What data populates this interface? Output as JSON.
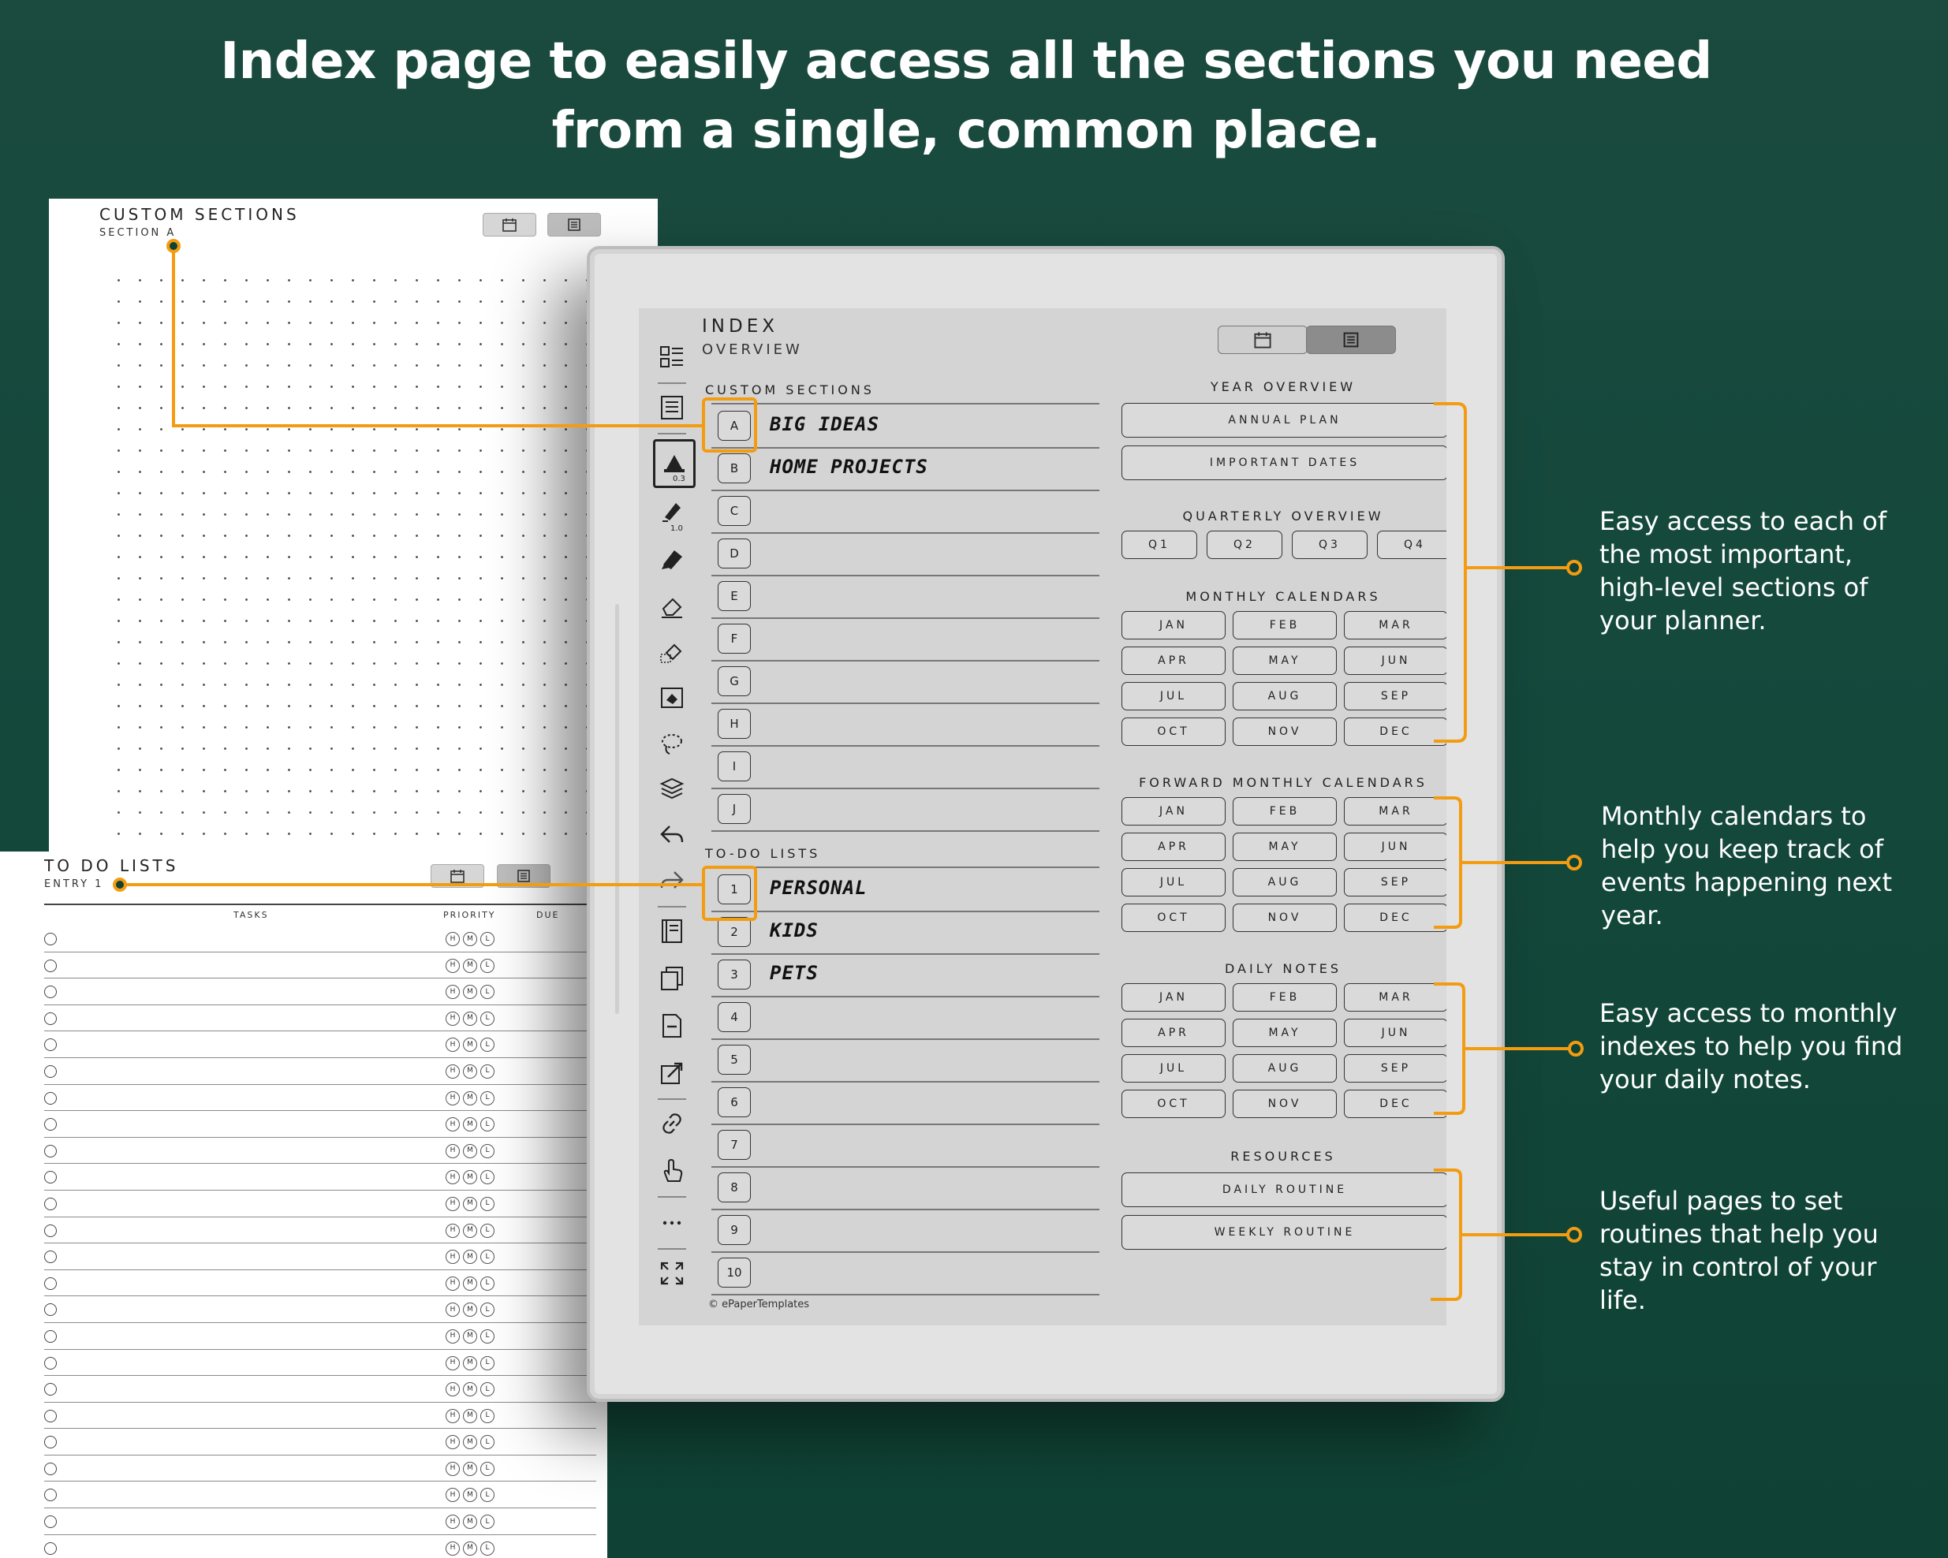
{
  "headline": {
    "line1": "Index page to easily access all the sections you need",
    "line2": "from a single, common place."
  },
  "page_a": {
    "title": "CUSTOM SECTIONS",
    "subtitle": "SECTION A"
  },
  "page_todo": {
    "title": "TO DO LISTS",
    "subtitle": "ENTRY 1",
    "col_tasks": "TASKS",
    "col_priority": "PRIORITY",
    "col_due": "DUE",
    "priority_levels": [
      "H",
      "M",
      "L"
    ]
  },
  "screen": {
    "title": "INDEX",
    "subtitle": "OVERVIEW",
    "custom_sections_label": "CUSTOM SECTIONS",
    "custom_sections": [
      {
        "key": "A",
        "text": "BIG IDEAS"
      },
      {
        "key": "B",
        "text": "HOME PROJECTS"
      },
      {
        "key": "C",
        "text": ""
      },
      {
        "key": "D",
        "text": ""
      },
      {
        "key": "E",
        "text": ""
      },
      {
        "key": "F",
        "text": ""
      },
      {
        "key": "G",
        "text": ""
      },
      {
        "key": "H",
        "text": ""
      },
      {
        "key": "I",
        "text": ""
      },
      {
        "key": "J",
        "text": ""
      }
    ],
    "todo_label": "TO-DO LISTS",
    "todo_lists": [
      {
        "key": "1",
        "text": "PERSONAL"
      },
      {
        "key": "2",
        "text": "KIDS"
      },
      {
        "key": "3",
        "text": "PETS"
      },
      {
        "key": "4",
        "text": ""
      },
      {
        "key": "5",
        "text": ""
      },
      {
        "key": "6",
        "text": ""
      },
      {
        "key": "7",
        "text": ""
      },
      {
        "key": "8",
        "text": ""
      },
      {
        "key": "9",
        "text": ""
      },
      {
        "key": "10",
        "text": ""
      }
    ],
    "year_overview_label": "YEAR OVERVIEW",
    "year_buttons": [
      "ANNUAL PLAN",
      "IMPORTANT DATES"
    ],
    "quarterly_label": "QUARTERLY OVERVIEW",
    "quarters": [
      "Q1",
      "Q2",
      "Q3",
      "Q4"
    ],
    "monthly_label": "MONTHLY CALENDARS",
    "forward_label": "FORWARD MONTHLY CALENDARS",
    "daily_label": "DAILY NOTES",
    "months": [
      "JAN",
      "FEB",
      "MAR",
      "APR",
      "MAY",
      "JUN",
      "JUL",
      "AUG",
      "SEP",
      "OCT",
      "NOV",
      "DEC"
    ],
    "resources_label": "RESOURCES",
    "resources": [
      "DAILY ROUTINE",
      "WEEKLY ROUTINE"
    ],
    "copyright": "© ePaperTemplates",
    "toolbar_labels": {
      "pen1": "0.3",
      "pen2": "1.0"
    }
  },
  "callouts": [
    "Easy access to each of the most important, high-level sections of your planner.",
    "Monthly calendars to help you keep track of events happening next year.",
    "Easy access to monthly indexes to help you find your daily notes.",
    "Useful pages to set routines that help you stay in control of your life."
  ],
  "colors": {
    "background": "#14493c",
    "accent": "#f39c12",
    "screen": "#d4d4d4"
  },
  "icons": [
    "calendar-icon",
    "list-icon",
    "toc-icon",
    "pen-icon",
    "eraser-icon",
    "lasso-icon",
    "layers-icon",
    "undo-icon",
    "redo-icon",
    "page-icon",
    "copy-icon",
    "export-icon",
    "link-icon",
    "touch-icon",
    "more-icon",
    "fullscreen-icon"
  ]
}
